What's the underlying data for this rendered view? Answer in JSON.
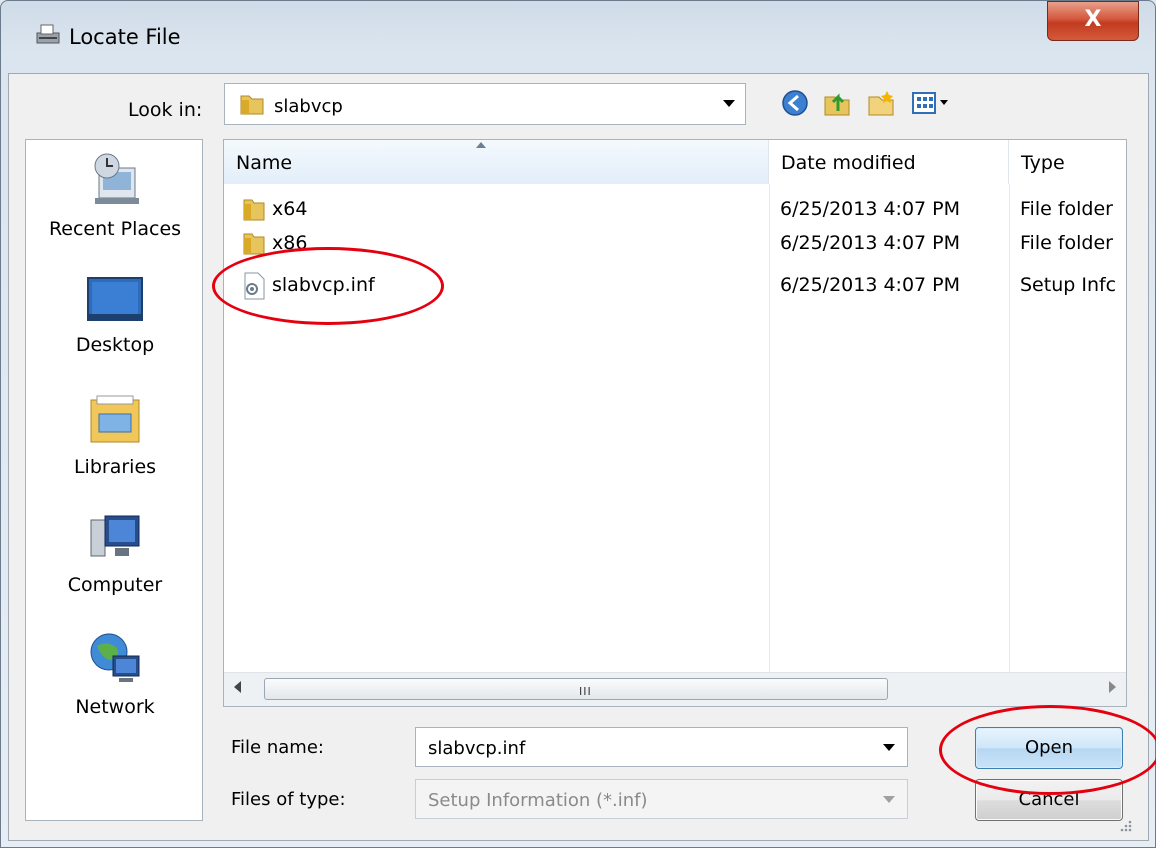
{
  "window": {
    "title": "Locate File",
    "close_label": "X"
  },
  "lookin": {
    "label": "Look in:",
    "value": "slabvcp"
  },
  "toolbar": {
    "icons": [
      "back-icon",
      "up-folder-icon",
      "new-folder-icon",
      "view-menu-icon"
    ]
  },
  "places": [
    {
      "label": "Recent Places",
      "icon": "recent-places-icon"
    },
    {
      "label": "Desktop",
      "icon": "desktop-icon"
    },
    {
      "label": "Libraries",
      "icon": "libraries-icon"
    },
    {
      "label": "Computer",
      "icon": "computer-icon"
    },
    {
      "label": "Network",
      "icon": "network-icon"
    }
  ],
  "file_list": {
    "columns": [
      "Name",
      "Date modified",
      "Type"
    ],
    "sorted_column": "Name",
    "rows": [
      {
        "name": "x64",
        "date": "6/25/2013 4:07 PM",
        "type": "File folder",
        "icon": "folder-icon"
      },
      {
        "name": "x86",
        "date": "6/25/2013 4:07 PM",
        "type": "File folder",
        "icon": "folder-icon"
      },
      {
        "name": "slabvcp.inf",
        "date": "6/25/2013 4:07 PM",
        "type": "Setup Infc",
        "icon": "setup-info-file-icon"
      }
    ],
    "scroll_grip": "III"
  },
  "filename": {
    "label": "File name:",
    "value": "slabvcp.inf"
  },
  "filetype": {
    "label": "Files of type:",
    "value": "Setup Information (*.inf)"
  },
  "buttons": {
    "open": "Open",
    "cancel": "Cancel"
  },
  "colors": {
    "annotation": "#e4000f",
    "default_button": "#b6d7f2"
  }
}
